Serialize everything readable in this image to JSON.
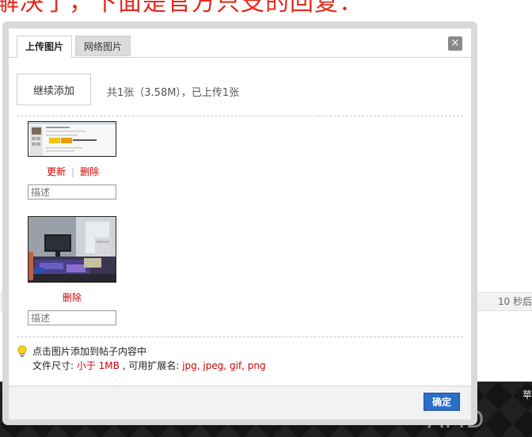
{
  "background": {
    "heading": "解决了，下面是官方只支的回复：",
    "row_time": "10 秒后",
    "dark_text": "苹",
    "logo_text": "AMD"
  },
  "dialog": {
    "tabs": [
      {
        "label": "上传图片",
        "active": true
      },
      {
        "label": "网络图片",
        "active": false
      }
    ],
    "close_symbol": "×",
    "add_more_label": "继续添加",
    "summary": "共1张（3.58M），已上传1张",
    "images": [
      {
        "actions": [
          "更新",
          "删除"
        ],
        "desc_placeholder": "描述"
      },
      {
        "actions": [
          "删除"
        ],
        "desc_placeholder": "描述"
      }
    ],
    "tip": {
      "icon": "lightbulb-icon",
      "line1": "点击图片添加到帖子内容中",
      "line2_prefix": "文件尺寸: ",
      "size_limit": "小于 1MB",
      "line2_mid": " , 可用扩展名: ",
      "extensions": "jpg, jpeg, gif, png"
    },
    "confirm_label": "确定"
  },
  "colors": {
    "accent_red": "#cc0000",
    "confirm_blue": "#2a6fc9",
    "heading_red": "#e8291c"
  }
}
